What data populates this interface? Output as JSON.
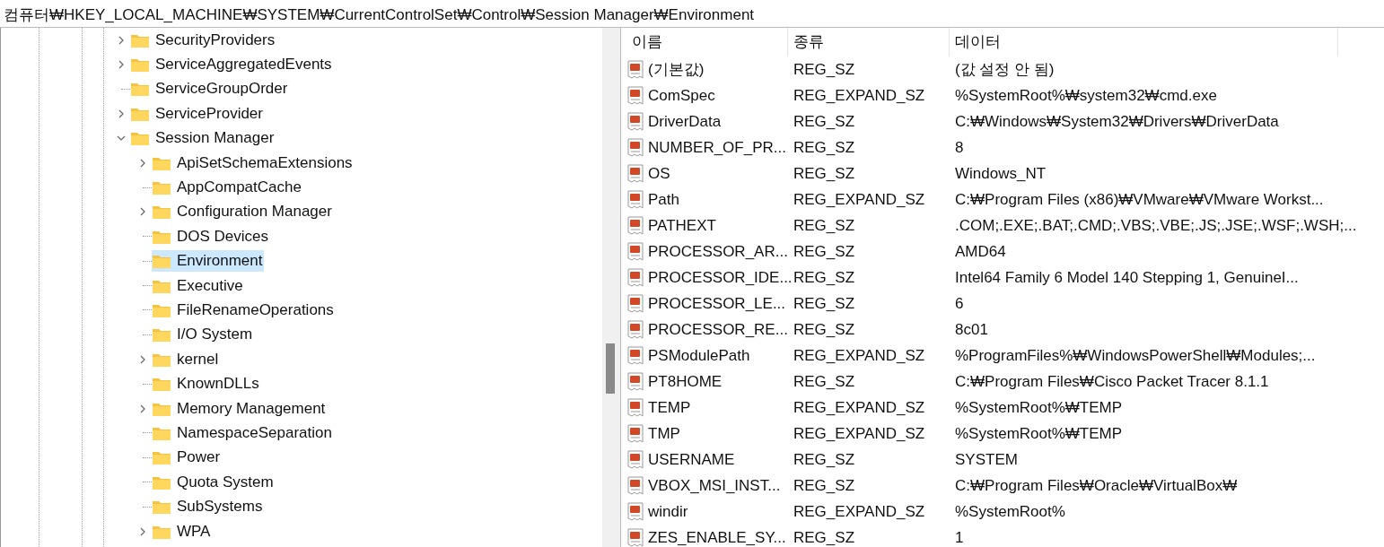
{
  "address_bar": {
    "path": "컴퓨터₩HKEY_LOCAL_MACHINE₩SYSTEM₩CurrentControlSet₩Control₩Session Manager₩Environment"
  },
  "tree": [
    {
      "label": "SecurityProviders",
      "has_subkeys": true,
      "expanded": false,
      "selected": false
    },
    {
      "label": "ServiceAggregatedEvents",
      "has_subkeys": true,
      "expanded": false,
      "selected": false
    },
    {
      "label": "ServiceGroupOrder",
      "has_subkeys": false,
      "expanded": false,
      "selected": false
    },
    {
      "label": "ServiceProvider",
      "has_subkeys": true,
      "expanded": false,
      "selected": false
    },
    {
      "label": "Session Manager",
      "has_subkeys": true,
      "expanded": true,
      "selected": false,
      "children": [
        {
          "label": "ApiSetSchemaExtensions",
          "has_subkeys": true,
          "expanded": false,
          "selected": false
        },
        {
          "label": "AppCompatCache",
          "has_subkeys": false,
          "expanded": false,
          "selected": false
        },
        {
          "label": "Configuration Manager",
          "has_subkeys": true,
          "expanded": false,
          "selected": false
        },
        {
          "label": "DOS Devices",
          "has_subkeys": false,
          "expanded": false,
          "selected": false
        },
        {
          "label": "Environment",
          "has_subkeys": false,
          "expanded": false,
          "selected": true
        },
        {
          "label": "Executive",
          "has_subkeys": false,
          "expanded": false,
          "selected": false
        },
        {
          "label": "FileRenameOperations",
          "has_subkeys": false,
          "expanded": false,
          "selected": false
        },
        {
          "label": "I/O System",
          "has_subkeys": false,
          "expanded": false,
          "selected": false
        },
        {
          "label": "kernel",
          "has_subkeys": true,
          "expanded": false,
          "selected": false
        },
        {
          "label": "KnownDLLs",
          "has_subkeys": false,
          "expanded": false,
          "selected": false
        },
        {
          "label": "Memory Management",
          "has_subkeys": true,
          "expanded": false,
          "selected": false
        },
        {
          "label": "NamespaceSeparation",
          "has_subkeys": false,
          "expanded": false,
          "selected": false
        },
        {
          "label": "Power",
          "has_subkeys": false,
          "expanded": false,
          "selected": false
        },
        {
          "label": "Quota System",
          "has_subkeys": false,
          "expanded": false,
          "selected": false
        },
        {
          "label": "SubSystems",
          "has_subkeys": false,
          "expanded": false,
          "selected": false
        },
        {
          "label": "WPA",
          "has_subkeys": true,
          "expanded": false,
          "selected": false
        }
      ]
    }
  ],
  "table": {
    "columns": [
      "이름",
      "종류",
      "데이터"
    ],
    "rows": [
      {
        "name": "(기본값)",
        "type": "REG_SZ",
        "data": "(값 설정 안 됨)"
      },
      {
        "name": "ComSpec",
        "type": "REG_EXPAND_SZ",
        "data": "%SystemRoot%₩system32₩cmd.exe"
      },
      {
        "name": "DriverData",
        "type": "REG_SZ",
        "data": "C:₩Windows₩System32₩Drivers₩DriverData"
      },
      {
        "name": "NUMBER_OF_PR...",
        "type": "REG_SZ",
        "data": "8"
      },
      {
        "name": "OS",
        "type": "REG_SZ",
        "data": "Windows_NT"
      },
      {
        "name": "Path",
        "type": "REG_EXPAND_SZ",
        "data": "C:₩Program Files (x86)₩VMware₩VMware Workst..."
      },
      {
        "name": "PATHEXT",
        "type": "REG_SZ",
        "data": ".COM;.EXE;.BAT;.CMD;.VBS;.VBE;.JS;.JSE;.WSF;.WSH;..."
      },
      {
        "name": "PROCESSOR_AR...",
        "type": "REG_SZ",
        "data": "AMD64"
      },
      {
        "name": "PROCESSOR_IDE...",
        "type": "REG_SZ",
        "data": "Intel64 Family 6 Model 140 Stepping 1, GenuineI..."
      },
      {
        "name": "PROCESSOR_LE...",
        "type": "REG_SZ",
        "data": "6"
      },
      {
        "name": "PROCESSOR_RE...",
        "type": "REG_SZ",
        "data": "8c01"
      },
      {
        "name": "PSModulePath",
        "type": "REG_EXPAND_SZ",
        "data": "%ProgramFiles%₩WindowsPowerShell₩Modules;..."
      },
      {
        "name": "PT8HOME",
        "type": "REG_SZ",
        "data": "C:₩Program Files₩Cisco Packet Tracer 8.1.1"
      },
      {
        "name": "TEMP",
        "type": "REG_EXPAND_SZ",
        "data": "%SystemRoot%₩TEMP"
      },
      {
        "name": "TMP",
        "type": "REG_EXPAND_SZ",
        "data": "%SystemRoot%₩TEMP"
      },
      {
        "name": "USERNAME",
        "type": "REG_SZ",
        "data": "SYSTEM"
      },
      {
        "name": "VBOX_MSI_INST...",
        "type": "REG_SZ",
        "data": "C:₩Program Files₩Oracle₩VirtualBox₩"
      },
      {
        "name": "windir",
        "type": "REG_EXPAND_SZ",
        "data": "%SystemRoot%"
      },
      {
        "name": "ZES_ENABLE_SY...",
        "type": "REG_SZ",
        "data": "1"
      }
    ]
  }
}
